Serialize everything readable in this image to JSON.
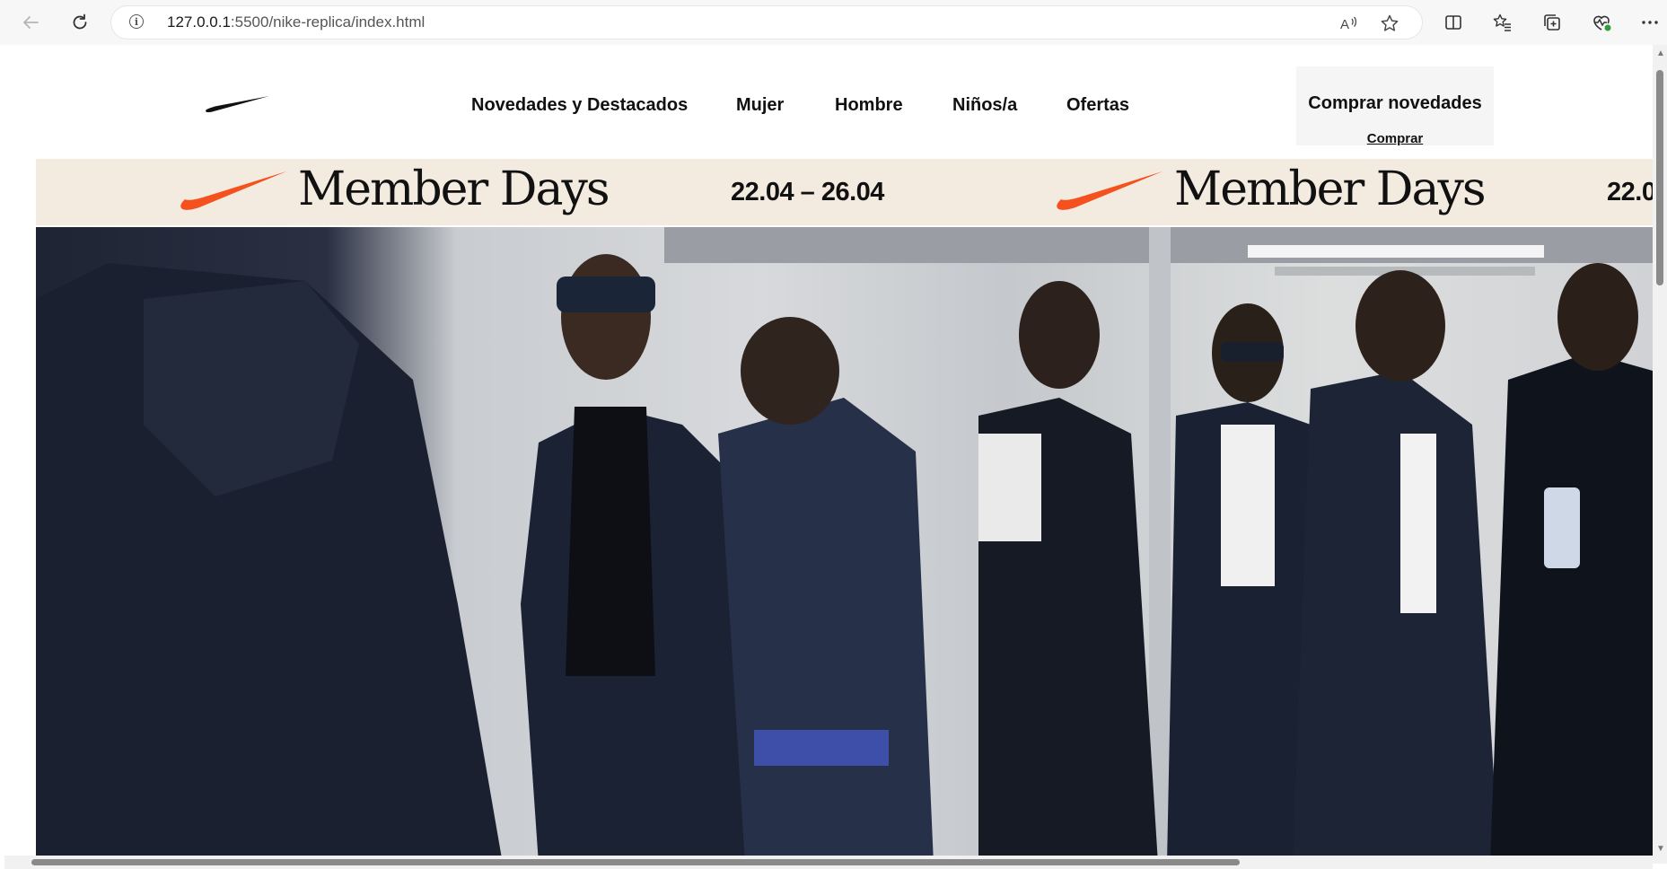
{
  "browser": {
    "url_host": "127.0.0.1",
    "url_path": ":5500/nike-replica/index.html",
    "icons": [
      "back-icon",
      "refresh-icon",
      "info-icon",
      "read-aloud-icon",
      "favorite-star-icon",
      "split-screen-icon",
      "favorites-icon",
      "collections-icon",
      "browser-essentials-icon",
      "more-icon"
    ]
  },
  "header": {
    "logo": "nike-swoosh-logo",
    "nav": [
      {
        "label": "Novedades y Destacados"
      },
      {
        "label": "Mujer"
      },
      {
        "label": "Hombre"
      },
      {
        "label": "Niños/a"
      },
      {
        "label": "Ofertas"
      }
    ],
    "promo": {
      "title": "Comprar novedades",
      "link": "Comprar"
    }
  },
  "banner": {
    "title": "Member Days",
    "dates": "22.04 – 26.04",
    "accent_color": "#f5511e",
    "background_color": "#f3ebe0"
  },
  "hero": {
    "description_alt": "hero-photo"
  }
}
